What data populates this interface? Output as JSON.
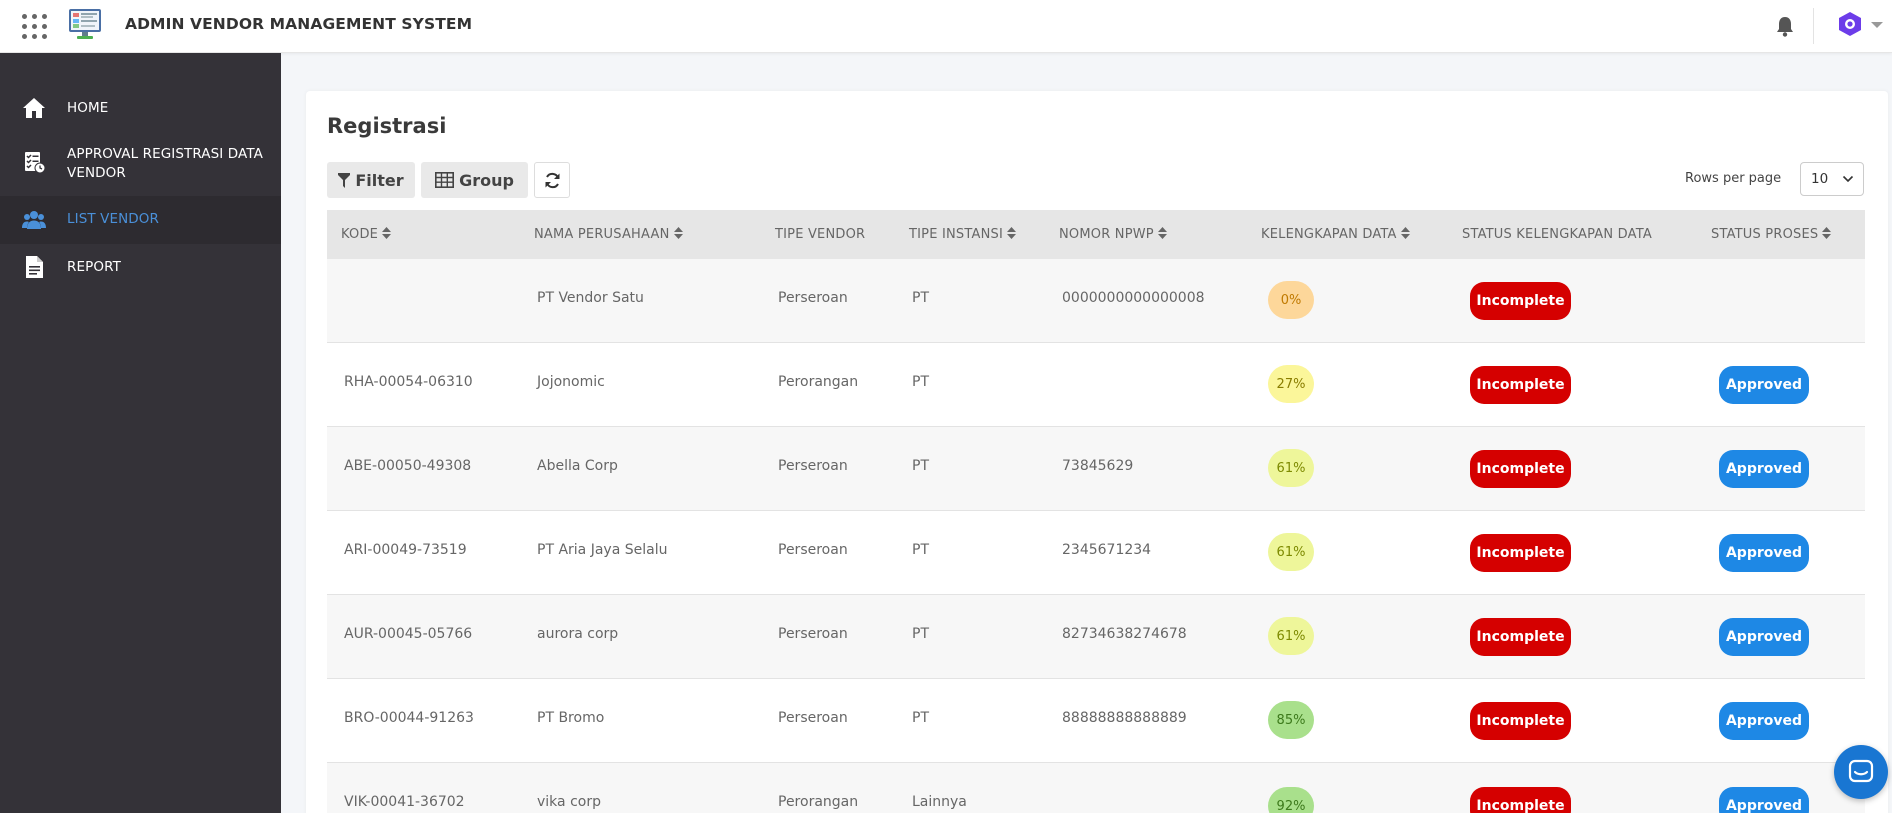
{
  "app": {
    "title": "ADMIN VENDOR MANAGEMENT SYSTEM"
  },
  "sidebar": {
    "items": [
      {
        "label": "HOME",
        "icon": "home-icon",
        "active": false
      },
      {
        "label_line1": "APPROVAL REGISTRASI DATA",
        "label_line2": "VENDOR",
        "icon": "checklist-icon",
        "active": false
      },
      {
        "label": "LIST VENDOR",
        "icon": "users-icon",
        "active": true
      },
      {
        "label": "REPORT",
        "icon": "document-icon",
        "active": false
      }
    ]
  },
  "page": {
    "title": "Registrasi"
  },
  "toolbar": {
    "filter_label": "Filter",
    "group_label": "Group",
    "rows_per_page_label": "Rows per page",
    "rows_per_page_value": "10"
  },
  "table": {
    "columns": [
      "KODE",
      "NAMA PERUSAHAAN",
      "TIPE VENDOR",
      "TIPE INSTANSI",
      "NOMOR NPWP",
      "KELENGKAPAN DATA",
      "STATUS KELENGKAPAN DATA",
      "STATUS PROSES"
    ],
    "rows": [
      {
        "kode": "",
        "nama": "PT Vendor Satu",
        "tipe_vendor": "Perseroan",
        "tipe_instansi": "PT",
        "npwp": "0000000000000008",
        "kelengkapan": "0%",
        "status_kelengkapan": "Incomplete",
        "status_proses": ""
      },
      {
        "kode": "RHA-00054-06310",
        "nama": "Jojonomic",
        "tipe_vendor": "Perorangan",
        "tipe_instansi": "PT",
        "npwp": "",
        "kelengkapan": "27%",
        "status_kelengkapan": "Incomplete",
        "status_proses": "Approved"
      },
      {
        "kode": "ABE-00050-49308",
        "nama": "Abella Corp",
        "tipe_vendor": "Perseroan",
        "tipe_instansi": "PT",
        "npwp": "73845629",
        "kelengkapan": "61%",
        "status_kelengkapan": "Incomplete",
        "status_proses": "Approved"
      },
      {
        "kode": "ARI-00049-73519",
        "nama": "PT Aria Jaya Selalu",
        "tipe_vendor": "Perseroan",
        "tipe_instansi": "PT",
        "npwp": "2345671234",
        "kelengkapan": "61%",
        "status_kelengkapan": "Incomplete",
        "status_proses": "Approved"
      },
      {
        "kode": "AUR-00045-05766",
        "nama": "aurora corp",
        "tipe_vendor": "Perseroan",
        "tipe_instansi": "PT",
        "npwp": "82734638274678",
        "kelengkapan": "61%",
        "status_kelengkapan": "Incomplete",
        "status_proses": "Approved"
      },
      {
        "kode": "BRO-00044-91263",
        "nama": "PT Bromo",
        "tipe_vendor": "Perseroan",
        "tipe_instansi": "PT",
        "npwp": "88888888888889",
        "kelengkapan": "85%",
        "status_kelengkapan": "Incomplete",
        "status_proses": "Approved"
      },
      {
        "kode": "VIK-00041-36702",
        "nama": "vika corp",
        "tipe_vendor": "Perorangan",
        "tipe_instansi": "Lainnya",
        "npwp": "",
        "kelengkapan": "92%",
        "status_kelengkapan": "Incomplete",
        "status_proses": "Approved"
      }
    ]
  },
  "colors": {
    "sidebar_bg": "#343238",
    "active_link": "#4a90d9",
    "incomplete": "#d50000",
    "approved": "#1e88e5",
    "pct_0": "#fdd79a",
    "pct_27": "#fbf69a",
    "pct_61": "#eef69a",
    "pct_85": "#a9e08c",
    "pct_92": "#a9e08c"
  }
}
